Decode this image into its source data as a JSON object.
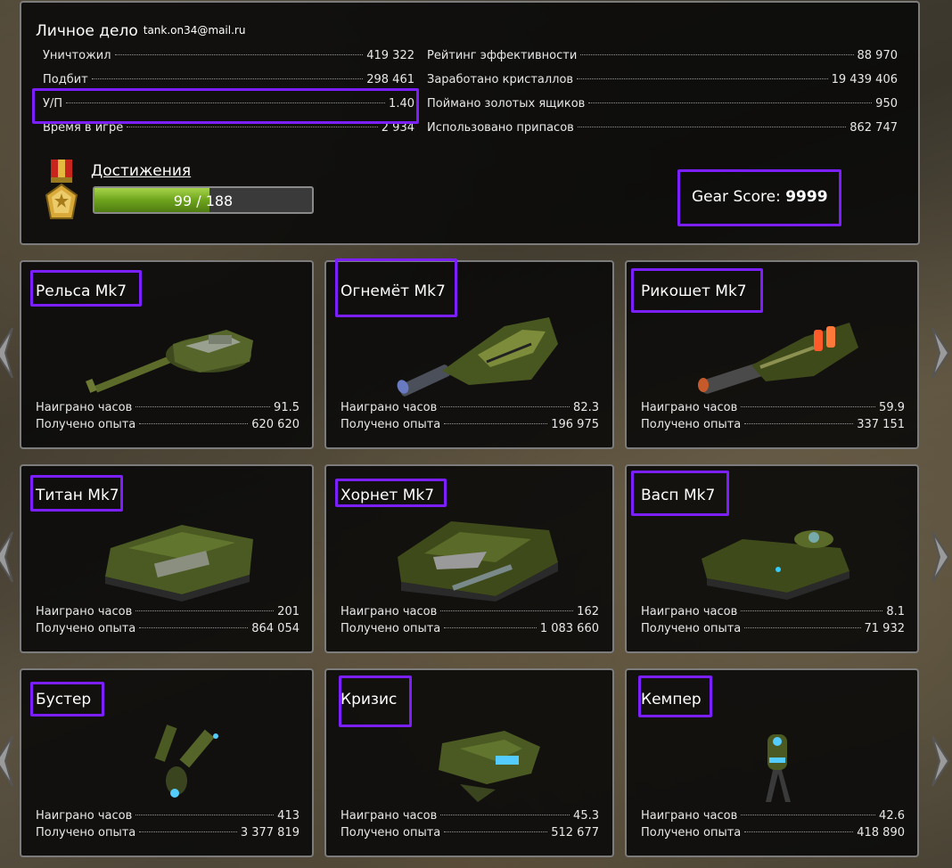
{
  "profile": {
    "title": "Личное дело",
    "email": "tank.on34@mail.ru",
    "left_stats": [
      {
        "label": "Уничтожил",
        "value": "419 322"
      },
      {
        "label": "Подбит",
        "value": "298 461"
      },
      {
        "label": "У/П",
        "value": "1.40"
      },
      {
        "label": "Время в игре",
        "value": "2 934"
      }
    ],
    "right_stats": [
      {
        "label": "Рейтинг эффективности",
        "value": "88 970"
      },
      {
        "label": "Заработано кристаллов",
        "value": "19 439 406"
      },
      {
        "label": "Поймано золотых ящиков",
        "value": "950"
      },
      {
        "label": "Использовано припасов",
        "value": "862 747"
      }
    ],
    "achievements_label": "Достижения",
    "achievements_progress": "99 / 188",
    "achievements_fraction": 0.527,
    "gear_label": "Gear Score:",
    "gear_value": "9999"
  },
  "cards": [
    {
      "title": "Рельса Mk7",
      "icon": "railgun-turret-icon",
      "hours_label": "Наиграно часов",
      "hours": "91.5",
      "xp_label": "Получено опыта",
      "xp": "620 620"
    },
    {
      "title": "Огнемёт Mk7",
      "icon": "flamethrower-turret-icon",
      "hours_label": "Наиграно часов",
      "hours": "82.3",
      "xp_label": "Получено опыта",
      "xp": "196 975"
    },
    {
      "title": "Рикошет Mk7",
      "icon": "ricochet-turret-icon",
      "hours_label": "Наиграно часов",
      "hours": "59.9",
      "xp_label": "Получено опыта",
      "xp": "337 151"
    },
    {
      "title": "Титан Mk7",
      "icon": "titan-hull-icon",
      "hours_label": "Наиграно часов",
      "hours": "201",
      "xp_label": "Получено опыта",
      "xp": "864 054"
    },
    {
      "title": "Хорнет Mk7",
      "icon": "hornet-hull-icon",
      "hours_label": "Наиграно часов",
      "hours": "162",
      "xp_label": "Получено опыта",
      "xp": "1 083 660"
    },
    {
      "title": "Васп Mk7",
      "icon": "wasp-hull-icon",
      "hours_label": "Наиграно часов",
      "hours": "8.1",
      "xp_label": "Получено опыта",
      "xp": "71 932"
    },
    {
      "title": "Бустер",
      "icon": "booster-drone-icon",
      "hours_label": "Наиграно часов",
      "hours": "413",
      "xp_label": "Получено опыта",
      "xp": "3 377 819"
    },
    {
      "title": "Кризис",
      "icon": "crisis-drone-icon",
      "hours_label": "Наиграно часов",
      "hours": "45.3",
      "xp_label": "Получено опыта",
      "xp": "512 677"
    },
    {
      "title": "Кемпер",
      "icon": "camper-drone-icon",
      "hours_label": "Наиграно часов",
      "hours": "42.6",
      "xp_label": "Получено опыта",
      "xp": "418 890"
    }
  ],
  "colors": {
    "highlight": "#7b1fff",
    "progress": "#6ea41d",
    "camo": "#4a5a22"
  }
}
